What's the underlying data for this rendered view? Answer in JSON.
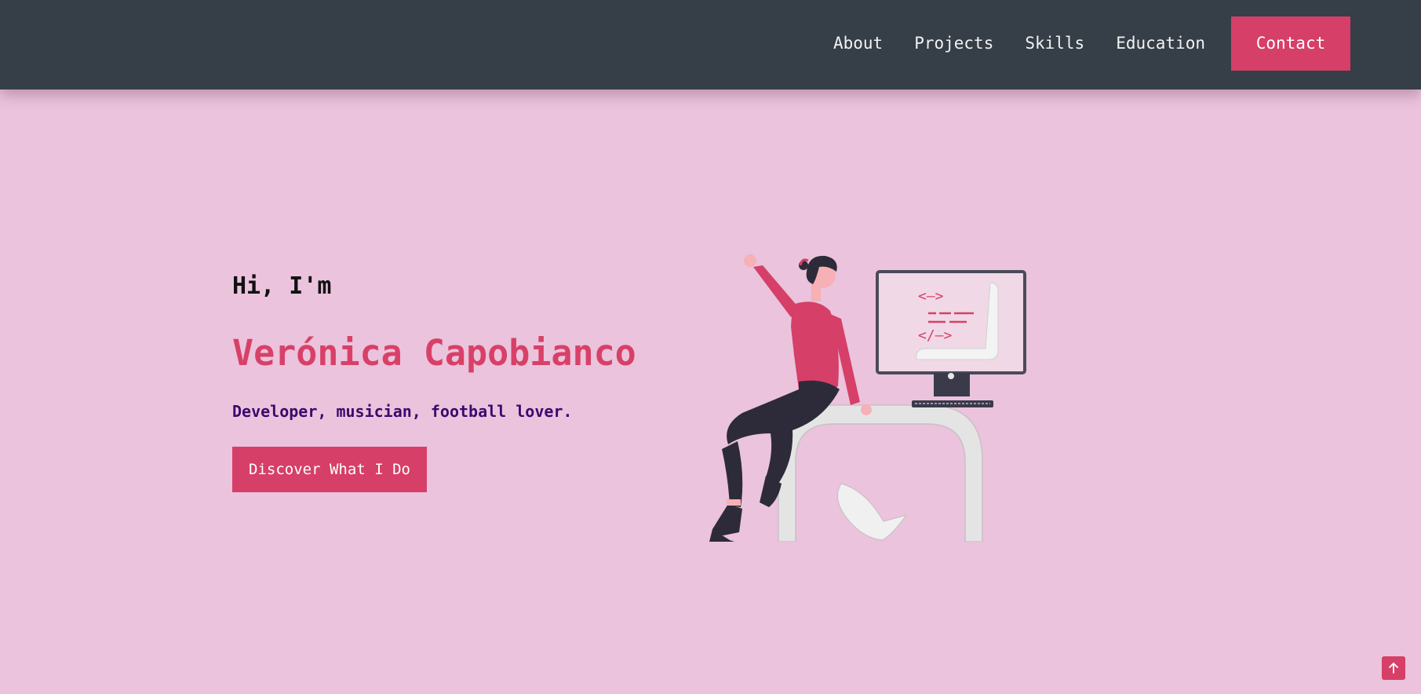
{
  "nav": {
    "items": [
      {
        "label": "About"
      },
      {
        "label": "Projects"
      },
      {
        "label": "Skills"
      },
      {
        "label": "Education"
      }
    ],
    "contact_label": "Contact"
  },
  "hero": {
    "greeting": "Hi, I'm",
    "name": "Verónica Capobianco",
    "tagline": "Developer, musician, football lover.",
    "cta_label": "Discover What I Do",
    "illustration_icon": "developer-at-desk-illustration",
    "monitor_code": {
      "line1": "<—>",
      "line3": "</—>"
    }
  },
  "scroll_top": {
    "icon": "arrow-up-icon"
  },
  "colors": {
    "background": "#ebc3dc",
    "navbar": "#363e47",
    "accent": "#d63f67",
    "tagline": "#3a0a6e"
  }
}
